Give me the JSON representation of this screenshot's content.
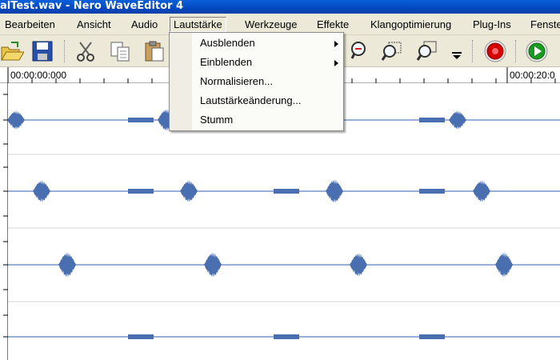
{
  "window": {
    "title": "alTest.wav - Nero WaveEditor 4"
  },
  "menu": {
    "items": [
      {
        "label": "Bearbeiten",
        "key": "B"
      },
      {
        "label": "Ansicht",
        "key": "A"
      },
      {
        "label": "Audio",
        "key": "u"
      },
      {
        "label": "Lautstärke",
        "key": "L"
      },
      {
        "label": "Werkzeuge",
        "key": "W"
      },
      {
        "label": "Effekte",
        "key": "k"
      },
      {
        "label": "Klangoptimierung",
        "key": "g"
      },
      {
        "label": "Plug-Ins",
        "key": "I"
      },
      {
        "label": "Fenster",
        "key": "F"
      }
    ]
  },
  "dropdown": {
    "items": [
      {
        "label": "Ausblenden",
        "submenu": true
      },
      {
        "label": "Einblenden",
        "submenu": true
      },
      {
        "label": "Normalisieren...",
        "submenu": false
      },
      {
        "label": "Lautstärkeänderung...",
        "submenu": false
      },
      {
        "label": "Stumm",
        "submenu": false
      }
    ]
  },
  "toolbar": {
    "icons": [
      "open-icon",
      "save-icon",
      "cut-icon",
      "copy-icon",
      "paste-icon",
      "zoom-icon",
      "zoom-selection-icon",
      "zoom-fit-icon",
      "dropdown-arrow-icon",
      "record-icon",
      "play-icon"
    ]
  },
  "ruler": {
    "start_label": "00:00:00:000",
    "end_label": "00:00:20:0"
  },
  "colors": {
    "waveform": "#4a6fb0",
    "titlebar": "#0348c0",
    "menubg": "#ece9d8",
    "record": "#d40000",
    "play": "#1a9a20"
  }
}
